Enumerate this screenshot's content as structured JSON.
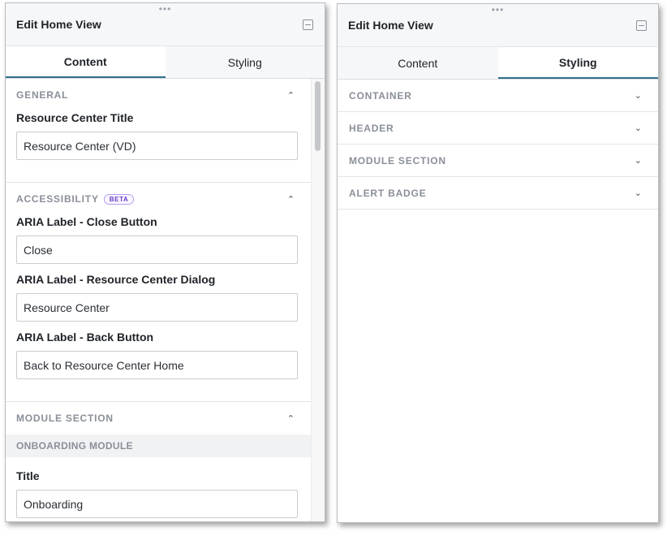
{
  "left": {
    "title": "Edit Home View",
    "drag_dots": "•••",
    "tabs": [
      {
        "label": "Content",
        "active": true
      },
      {
        "label": "Styling",
        "active": false
      }
    ],
    "general": {
      "title": "GENERAL",
      "field_label": "Resource Center Title",
      "field_value": "Resource Center (VD)"
    },
    "accessibility": {
      "title": "ACCESSIBILITY",
      "badge": "BETA",
      "fields": [
        {
          "label": "ARIA Label - Close Button",
          "value": "Close"
        },
        {
          "label": "ARIA Label - Resource Center Dialog",
          "value": "Resource Center"
        },
        {
          "label": "ARIA Label - Back Button",
          "value": "Back to Resource Center Home"
        }
      ]
    },
    "module_section": {
      "title": "MODULE SECTION",
      "subsection": "ONBOARDING MODULE",
      "field_label": "Title",
      "field_value": "Onboarding"
    }
  },
  "right": {
    "title": "Edit Home View",
    "drag_dots": "•••",
    "tabs": [
      {
        "label": "Content",
        "active": false
      },
      {
        "label": "Styling",
        "active": true
      }
    ],
    "sections": [
      "CONTAINER",
      "HEADER",
      "MODULE SECTION",
      "ALERT BADGE"
    ]
  },
  "icons": {
    "chevron_up": "⌃",
    "chevron_down": "⌄"
  },
  "colors": {
    "accent": "#2f6f8c",
    "beta": "#6a3dcc"
  }
}
